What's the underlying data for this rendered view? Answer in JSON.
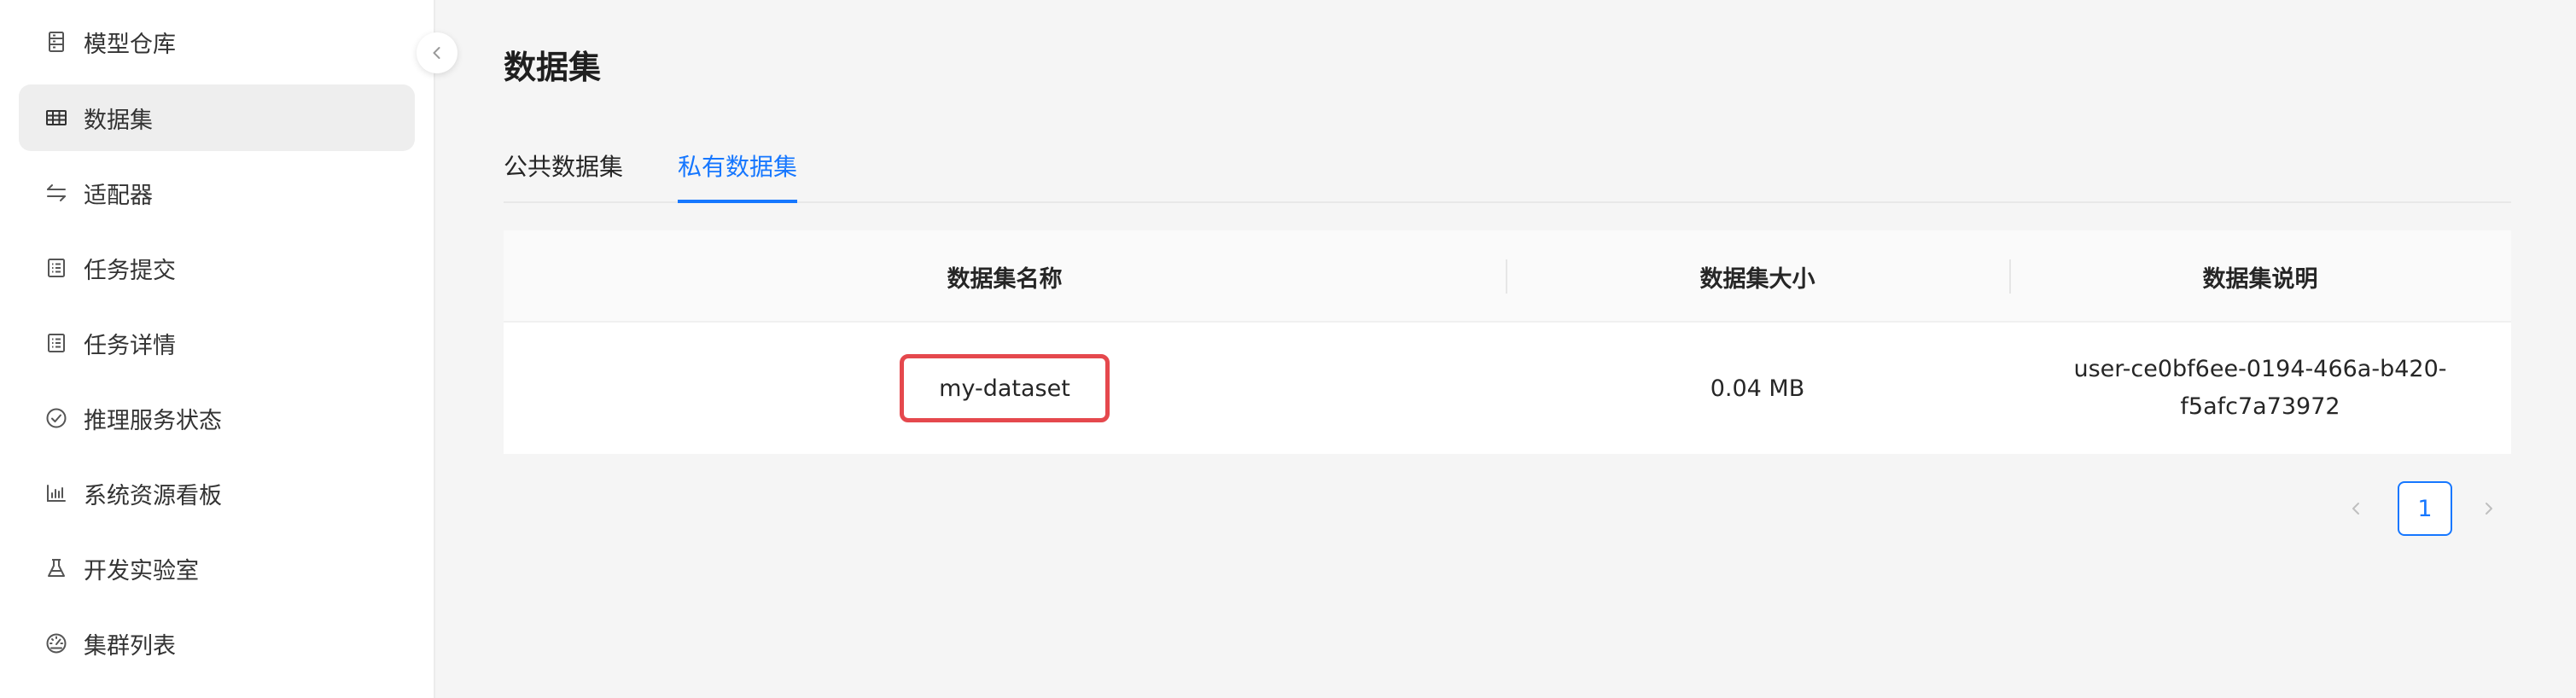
{
  "sidebar": {
    "items": [
      {
        "label": "模型仓库",
        "icon": "model-repo-icon"
      },
      {
        "label": "数据集",
        "icon": "table-icon"
      },
      {
        "label": "适配器",
        "icon": "arrows-swap-icon"
      },
      {
        "label": "任务提交",
        "icon": "list-doc-icon"
      },
      {
        "label": "任务详情",
        "icon": "list-doc-icon"
      },
      {
        "label": "推理服务状态",
        "icon": "check-circle-icon"
      },
      {
        "label": "系统资源看板",
        "icon": "bar-chart-icon"
      },
      {
        "label": "开发实验室",
        "icon": "flask-icon"
      },
      {
        "label": "集群列表",
        "icon": "dashboard-icon"
      }
    ],
    "active_index": 1,
    "collapse_icon": "chevron-left-icon"
  },
  "page": {
    "title": "数据集"
  },
  "tabs": [
    {
      "label": "公共数据集",
      "active": false
    },
    {
      "label": "私有数据集",
      "active": true
    }
  ],
  "table": {
    "columns": [
      "数据集名称",
      "数据集大小",
      "数据集说明"
    ],
    "rows": [
      {
        "name": "my-dataset",
        "size": "0.04 MB",
        "description": "user-ce0bf6ee-0194-466a-b420-f5afc7a73972"
      }
    ]
  },
  "pagination": {
    "current_page": "1",
    "prev_icon": "chevron-left-icon",
    "next_icon": "chevron-right-icon"
  },
  "colors": {
    "accent": "#1677ff",
    "highlight_box": "#e5484d",
    "active_nav_bg": "#eeeeee"
  }
}
